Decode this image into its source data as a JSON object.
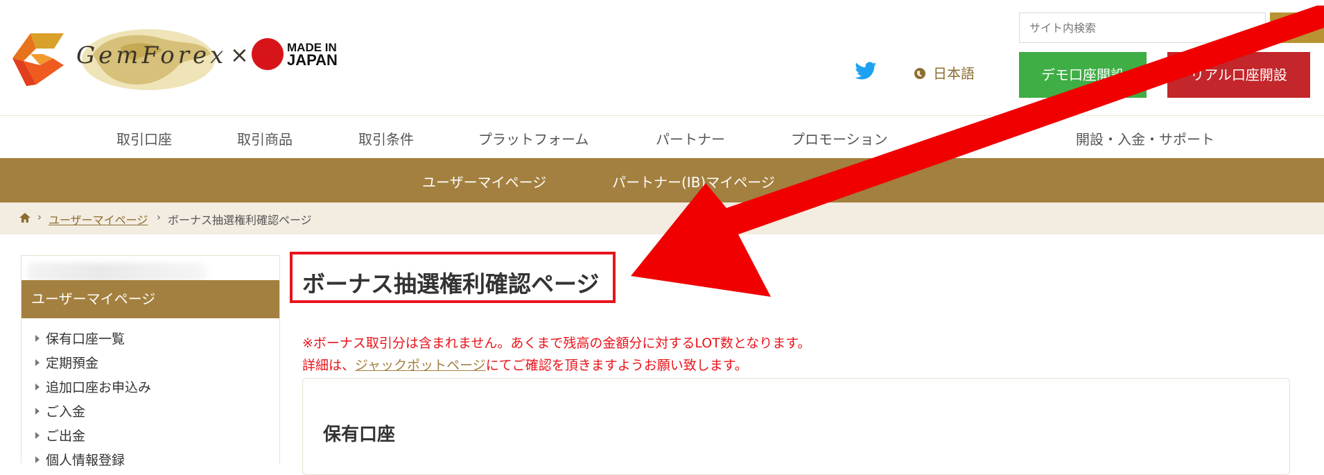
{
  "header": {
    "logo_text": "GemForex",
    "logo_times": "×",
    "made_in": "MADE IN",
    "japan": "JAPAN",
    "search_placeholder": "サイト内検索",
    "language": "日本語",
    "demo_button": "デモ口座開設",
    "real_button": "リアル口座開設"
  },
  "nav": {
    "items": [
      "取引口座",
      "取引商品",
      "取引条件",
      "プラットフォーム",
      "パートナー",
      "プロモーション",
      "開設・入金・サポート"
    ]
  },
  "subnav": {
    "items": [
      "ユーザーマイページ",
      "パートナー(IB)マイページ"
    ]
  },
  "breadcrumb": {
    "separator": "›",
    "link": "ユーザーマイページ",
    "current": "ボーナス抽選権利確認ページ"
  },
  "sidebar": {
    "heading": "ユーザーマイページ",
    "items": [
      "保有口座一覧",
      "定期預金",
      "追加口座お申込み",
      "ご入金",
      "ご出金",
      "個人情報登録"
    ]
  },
  "main": {
    "title": "ボーナス抽選権利確認ページ",
    "notice_line1": "※ボーナス取引分は含まれません。あくまで残高の金額分に対するLOT数となります。",
    "notice_line2_pre": "詳細は、",
    "notice_link": "ジャックポットページ",
    "notice_line2_post": "にてご確認を頂きますようお願い致します。",
    "card_title": "保有口座"
  },
  "colors": {
    "brand_gold": "#a3803f",
    "demo_green": "#3eae45",
    "real_red": "#c3262b",
    "annotation_red": "#e8141b",
    "twitter_blue": "#1da1f2"
  },
  "icons": [
    "logo-mark",
    "twitter-icon",
    "globe-icon",
    "home-icon",
    "search-icon",
    "triangle-bullet-icon"
  ]
}
